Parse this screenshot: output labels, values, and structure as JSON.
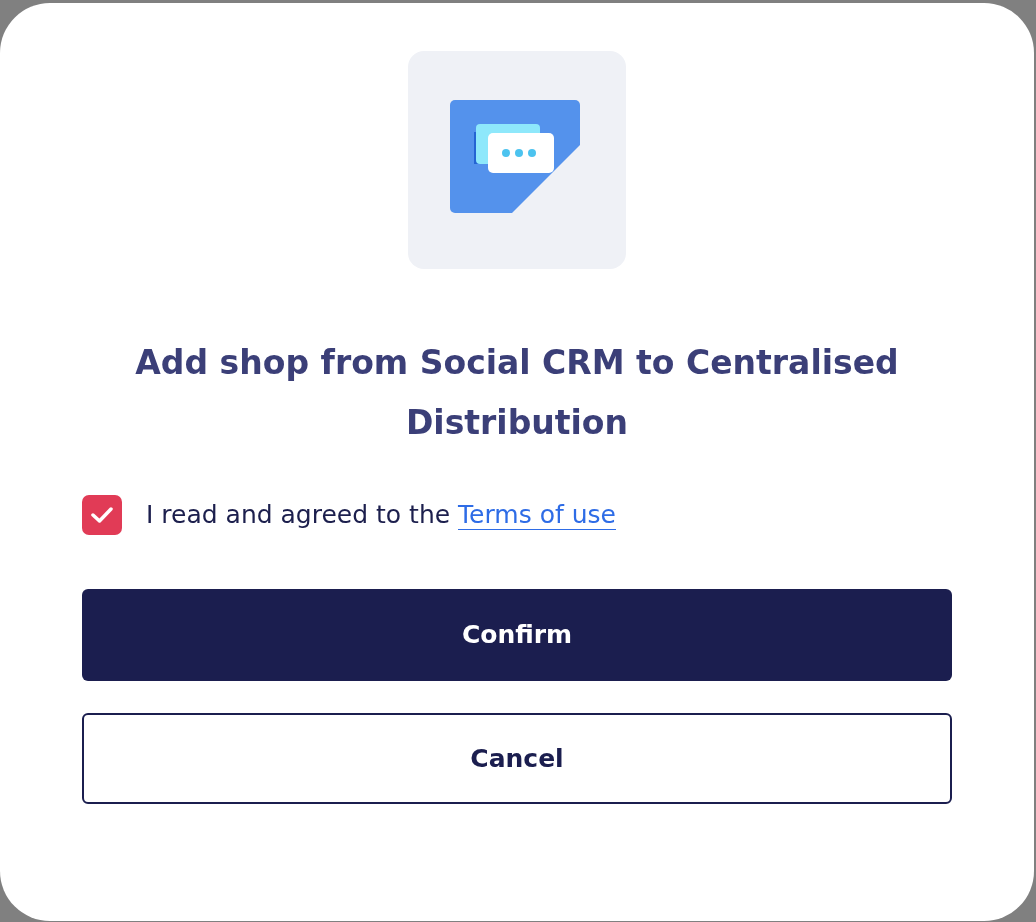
{
  "dialog": {
    "title": "Add shop from Social CRM to Centralised Distribution",
    "agreement": {
      "checked": true,
      "text": "I read and agreed to the",
      "link": "Terms of use"
    },
    "buttons": [
      {
        "kind": "primary",
        "label": "Confirm"
      },
      {
        "kind": "secondary",
        "label": "Cancel"
      }
    ]
  }
}
